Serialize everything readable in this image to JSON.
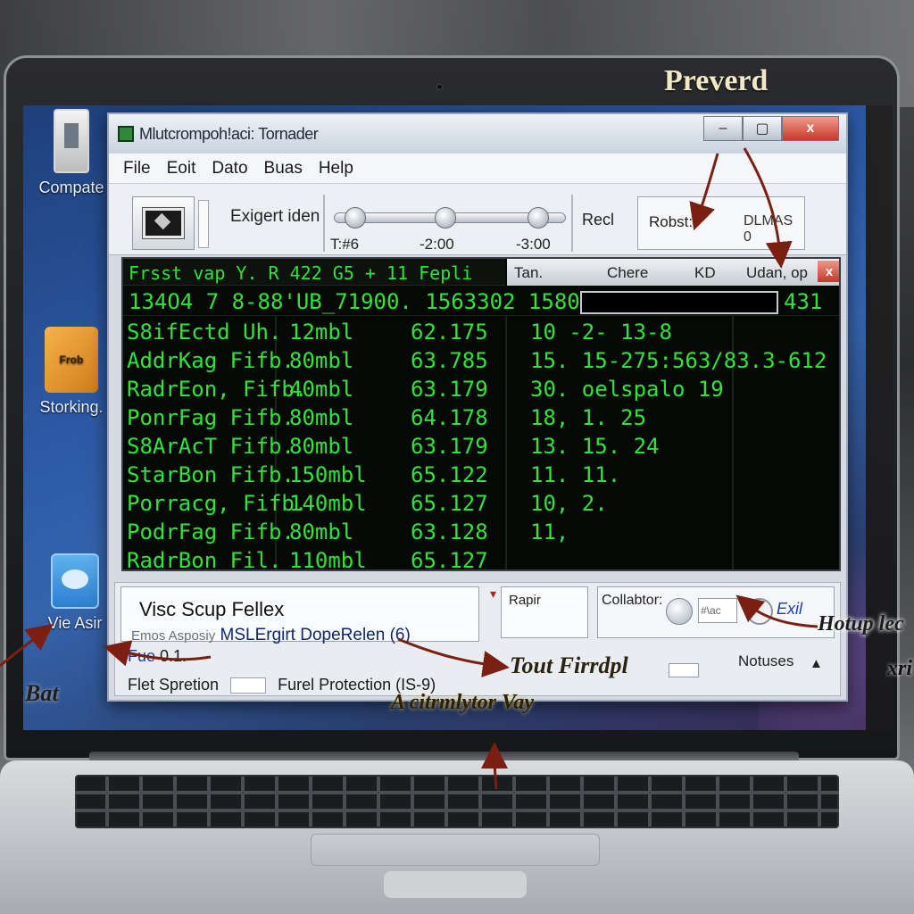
{
  "overlay_title": "Preverd",
  "desktop": {
    "icons": [
      {
        "label": "Compate"
      },
      {
        "label": "Storking.",
        "badge": "Frob"
      },
      {
        "label": "Vie Asir"
      }
    ],
    "bat_label": "Bat"
  },
  "window": {
    "title": "Mlutcrompoh!aci: Tornader",
    "controls": {
      "minimize": "–",
      "maximize": "▢",
      "close": "x"
    },
    "menu": [
      "File",
      "Eoit",
      "Dato",
      "Buas",
      "Help"
    ],
    "toolbar": {
      "expert_label": "Exigert iden",
      "slider": {
        "ticks": [
          "T:#6",
          "-2:00",
          "-3:00"
        ],
        "level_percent": [
          5,
          48,
          92
        ]
      },
      "reci_label": "Recl",
      "robust_label": "Robst:",
      "robust_value": "DLMAS 0"
    },
    "data_panel": {
      "left_header": "Frsst vap Y. R 422 G5 + 11 Fepli",
      "right_header": {
        "col1": "Tan.",
        "col2": "Chere",
        "col3": "KD",
        "col4": "Udan, op",
        "close": "x"
      },
      "id_row": "134O4 7 8-88'UB_71900. 1563302 1580.",
      "id_row_right": "431",
      "rows": [
        {
          "name": "S8ifEctd Uh.",
          "size": "12mbl",
          "value": "62.175",
          "rest": "10 -2- 13-8"
        },
        {
          "name": "AddrKag Fifb.",
          "size": "80mbl",
          "value": "63.785",
          "rest": "15. 15-275:563/83.3-612"
        },
        {
          "name": "RadrEon, Fifb.",
          "size": "40mbl",
          "value": "63.179",
          "rest": "30. oelspalo 19"
        },
        {
          "name": "PonrFag Fifb.",
          "size": "80mbl",
          "value": "64.178",
          "rest": "18, 1. 25"
        },
        {
          "name": "S8ArAcT Fifb.",
          "size": "80mbl",
          "value": "63.179",
          "rest": "13. 15. 24"
        },
        {
          "name": "StarBon Fifb.",
          "size": "150mbl",
          "value": "65.122",
          "rest": "11. 11."
        },
        {
          "name": "Porracg, Fifb.",
          "size": "140mbl",
          "value": "65.127",
          "rest": "10, 2."
        },
        {
          "name": "PodrFag Fifb.",
          "size": "80mbl",
          "value": "63.128",
          "rest": "11,"
        },
        {
          "name": "RadrBon Fil.",
          "size": "110mbl",
          "value": "65.127",
          "rest": ""
        }
      ]
    },
    "bottom": {
      "visc_label": "Visc Scup Fellex",
      "repir_label": "Rapir",
      "collab_label": "Collabtor:",
      "collab_field": "#\\ac",
      "exit_label": "Exil",
      "ms_prefix": "Emos Asposiy",
      "ms_text": "MSLErgirt DopeRelen",
      "ms_suffix": "(6)",
      "fue_prefix": "Fue",
      "fue_value": "0.1.",
      "tout_label": "Tout Firrdpl",
      "notuses_label": "Notuses",
      "flet_label": "Flet Spretion",
      "furel_label": "Furel Protection (IS-9)"
    }
  },
  "annotations": {
    "hotup": "Hotup lec",
    "xri": "xri",
    "eternity": "A citrmlytor Vay"
  },
  "colors": {
    "terminal_green": "#2fe53a",
    "annotation_arrow": "#7a1f12",
    "close_red": "#c9382a"
  }
}
